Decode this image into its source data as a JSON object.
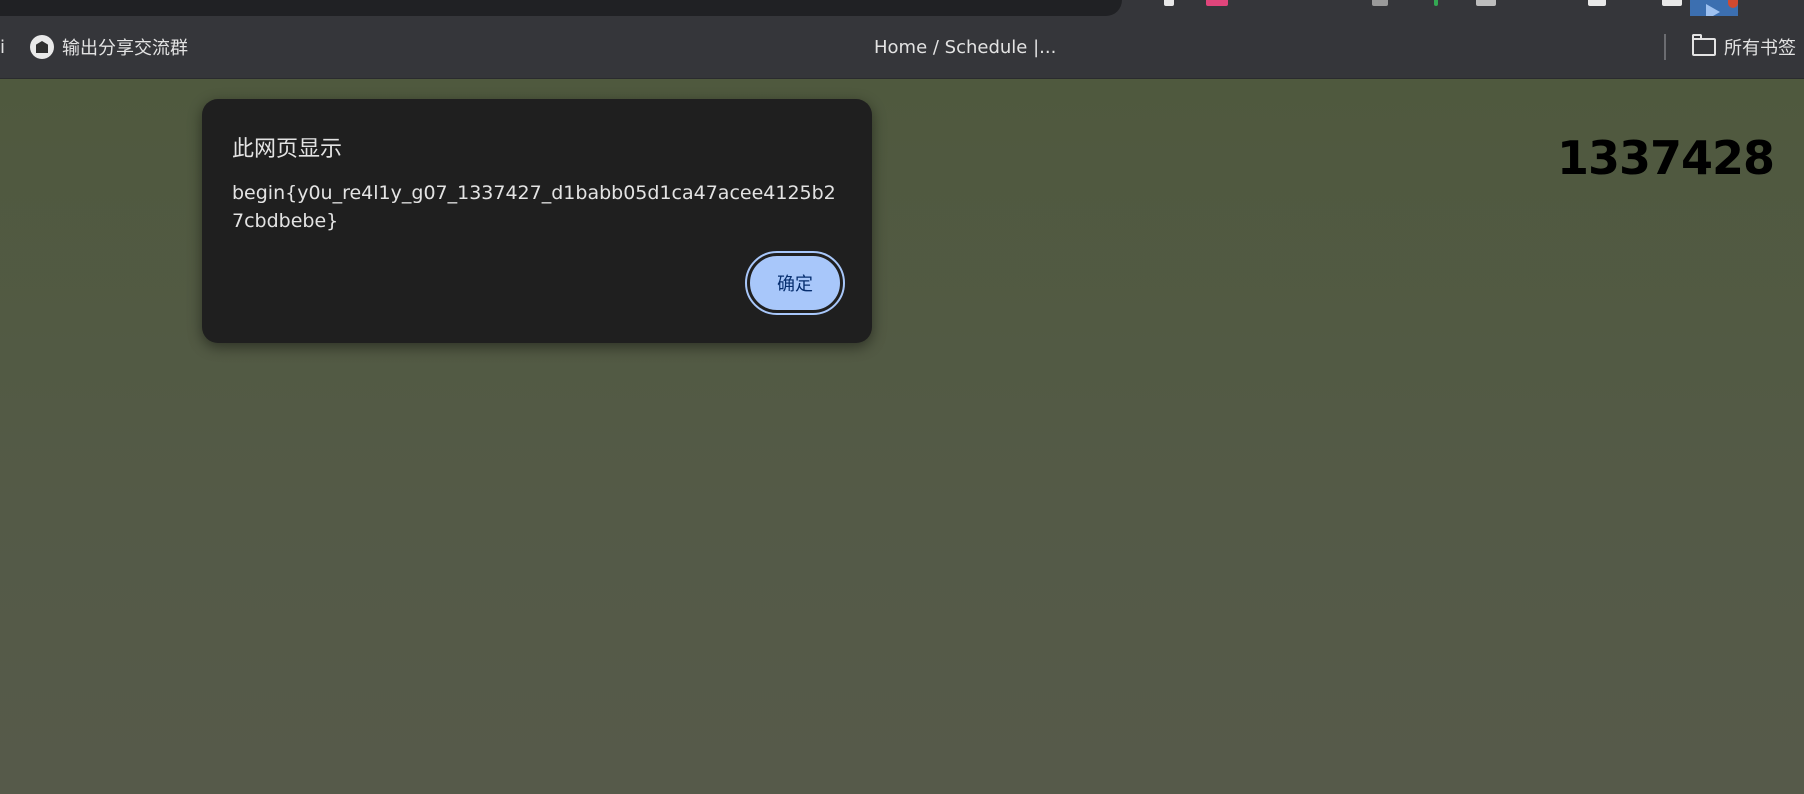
{
  "browser": {
    "bookmarks": [
      {
        "label": "i"
      },
      {
        "label": "输出分享交流群"
      },
      {
        "label": "Home / Schedule |..."
      }
    ],
    "all_bookmarks_label": "所有书签"
  },
  "page": {
    "counter": "1337428"
  },
  "dialog": {
    "title": "此网页显示",
    "message": "begin{y0u_re4l1y_g07_1337427_d1babb05d1ca47acee4125b27cbdbebe}",
    "ok_label": "确定"
  },
  "colors": {
    "page_background": "#515a40",
    "dialog_background": "#1f1f1f",
    "button_background": "#a8c7fa",
    "chrome_background": "#35363a"
  }
}
